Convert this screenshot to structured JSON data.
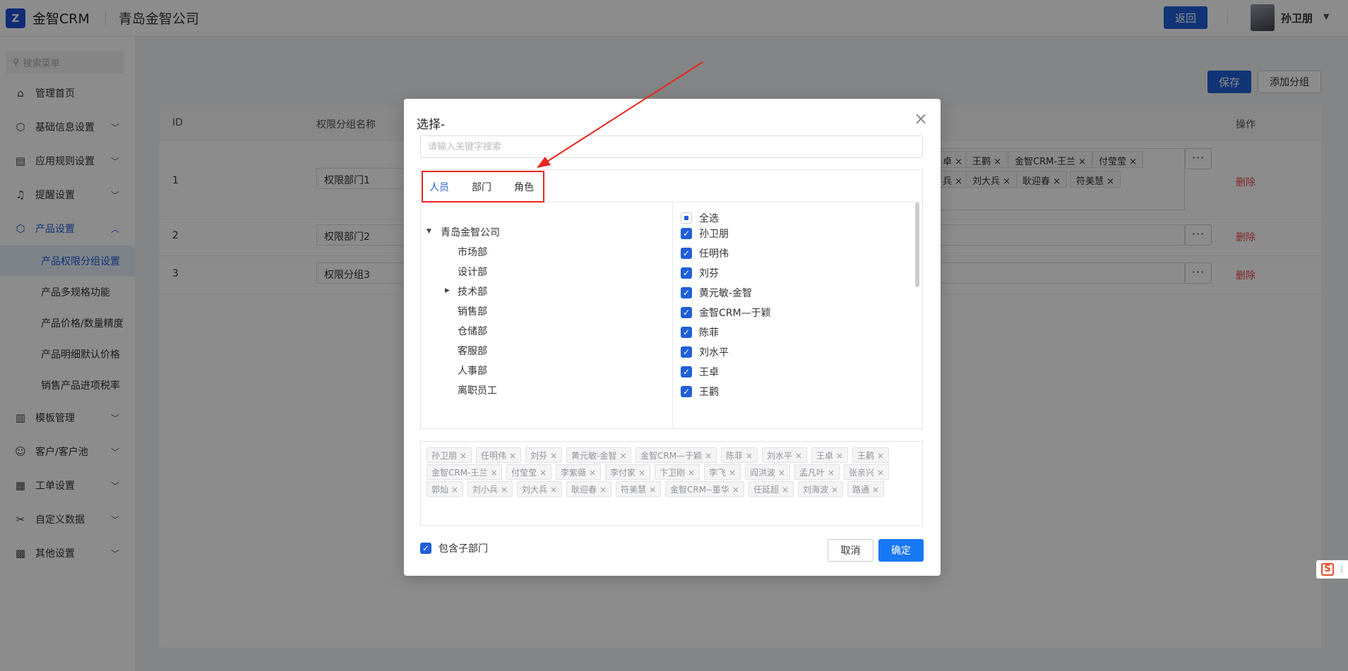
{
  "header": {
    "logo_glyph": "Z",
    "app_name": "金智CRM",
    "company": "青岛金智公司",
    "back_label": "返回",
    "user_name": "孙卫朋",
    "user_caret": "▼"
  },
  "sidebar": {
    "search_placeholder": "搜索菜单",
    "menu": [
      {
        "label": "管理首页",
        "icon": "home-icon",
        "glyph": "⌂"
      },
      {
        "label": "基础信息设置",
        "icon": "cube-icon",
        "glyph": "⬡"
      },
      {
        "label": "应用规则设置",
        "icon": "document-icon",
        "glyph": "▤"
      },
      {
        "label": "提醒设置",
        "icon": "bell-icon",
        "glyph": "♫"
      },
      {
        "label": "产品设置",
        "icon": "box-icon",
        "glyph": "⬡"
      },
      {
        "label": "模板管理",
        "icon": "template-icon",
        "glyph": "▥"
      },
      {
        "label": "客户/客户池",
        "icon": "user-icon",
        "glyph": "☺"
      },
      {
        "label": "工单设置",
        "icon": "form-icon",
        "glyph": "▦"
      },
      {
        "label": "自定义数据",
        "icon": "tools-icon",
        "glyph": "✂"
      },
      {
        "label": "其他设置",
        "icon": "apps-icon",
        "glyph": "▩"
      }
    ],
    "product_sub": [
      {
        "label": "产品权限分组设置"
      },
      {
        "label": "产品多规格功能"
      },
      {
        "label": "产品价格/数量精度"
      },
      {
        "label": "产品明细默认价格"
      },
      {
        "label": "销售产品进项税率"
      }
    ]
  },
  "page": {
    "save_label": "保存",
    "add_group_label": "添加分组",
    "col_id": "ID",
    "col_name": "权限分组名称",
    "col_ops": "操作",
    "rows": [
      {
        "id": "1",
        "name": "权限部门1",
        "delete": "删除"
      },
      {
        "id": "2",
        "name": "权限部门2",
        "delete": "删除"
      },
      {
        "id": "3",
        "name": "权限分组3",
        "delete": "删除"
      }
    ],
    "row1_tags_line1": [
      "卓 ×",
      "王鹳 ×",
      "金智CRM-王兰 ×",
      "付莹莹 ×"
    ],
    "row1_tags_line2": [
      "兵 ×",
      "刘大兵 ×",
      "耿迎春 ×",
      "符美慧 ×"
    ],
    "dots": "···"
  },
  "dialog": {
    "title": "选择-",
    "close": "×",
    "search_placeholder": "请输入关键字搜索",
    "tabs": [
      "人员",
      "部门",
      "角色"
    ],
    "tree": {
      "root": "青岛金智公司",
      "children": [
        "市场部",
        "设计部",
        "技术部",
        "销售部",
        "仓储部",
        "客服部",
        "人事部",
        "离职员工"
      ]
    },
    "select_all": "全选",
    "people": [
      "孙卫朋",
      "任明伟",
      "刘芬",
      "黄元敏-金智",
      "金智CRM—于颖",
      "陈菲",
      "刘水平",
      "王卓",
      "王鹳"
    ],
    "check_glyph": "✓",
    "selected_chips": [
      "孙卫朋",
      "任明伟",
      "刘芬",
      "黄元敏-金智",
      "金智CRM—于颖",
      "陈菲",
      "刘水平",
      "王卓",
      "王鹳",
      "金智CRM-王兰",
      "付莹莹",
      "李紫薇",
      "李付家",
      "卞卫刚",
      "李飞",
      "阎洪波",
      "孟凡叶",
      "张亲兴",
      "郭灿",
      "刘小兵",
      "刘大兵",
      "耿迎春",
      "符美慧",
      "金智CRM--董华",
      "任延超",
      "刘海波",
      "路通"
    ],
    "chip_x": "×",
    "include_sub": "包含子部门",
    "cancel_label": "取消",
    "ok_label": "确定"
  },
  "side_tool": {
    "glyph": "S",
    "dots": "⋮"
  },
  "colors": {
    "primary": "#1f5fd8",
    "danger": "#e84949",
    "annotation": "#e8261e"
  }
}
